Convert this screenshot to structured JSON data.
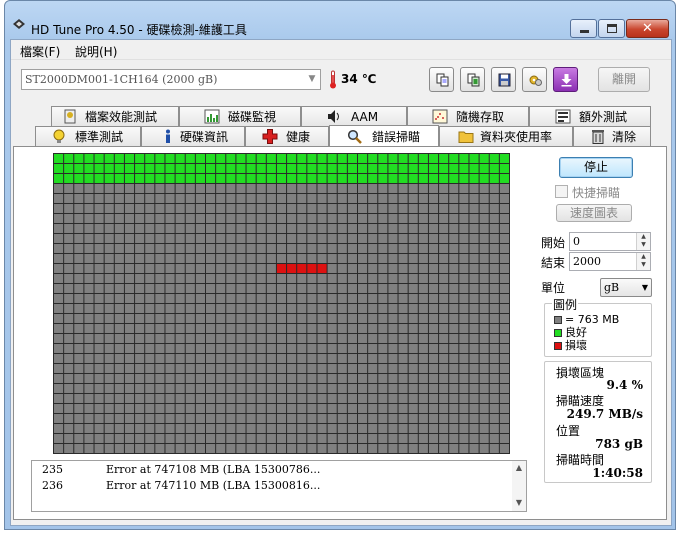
{
  "window": {
    "title": "HD Tune Pro 4.50 - 硬碟檢測-維護工具",
    "minimize_label": "–",
    "close_glyph": "✕"
  },
  "menu": {
    "file": "檔案(F)",
    "help": "說明(H)"
  },
  "toolbar": {
    "drive": "ST2000DM001-1CH164 (2000 gB)",
    "temperature": "34 ℃",
    "exit_label": "離開",
    "icons": [
      "copy-info-icon",
      "copy-screenshot-icon",
      "save-icon",
      "options-icon",
      "download-icon"
    ]
  },
  "tabs": {
    "row1": [
      "檔案效能測試",
      "磁碟監視",
      "AAM",
      "隨機存取",
      "額外測試"
    ],
    "row2": [
      "標準測試",
      "硬碟資訊",
      "健康",
      "錯誤掃瞄",
      "資料夾使用率",
      "清除"
    ],
    "active": "錯誤掃瞄"
  },
  "scan": {
    "grid_cols": 45,
    "grid_rows": 30,
    "scanned_fraction": 0.094,
    "damaged_row": 11,
    "damaged_col_start": 22,
    "damaged_col_end": 27,
    "colors": {
      "good": "#22dd22",
      "bad": "#dd1111",
      "unscanned": "#808080",
      "grid": "#2a2a2a"
    }
  },
  "controls": {
    "stop_label": "停止",
    "quick_scan_label": "快捷掃瞄",
    "speed_map_label": "速度圖表",
    "start_label": "開始",
    "start_value": "0",
    "end_label": "結束",
    "end_value": "2000",
    "unit_label": "單位",
    "unit_value": "gB"
  },
  "legend": {
    "title": "圖例",
    "block_size": "= 763 MB",
    "good": "良好",
    "damaged": "損壞"
  },
  "stats": {
    "damaged_blocks_label": "損壞區塊",
    "damaged_blocks_value": "9.4 %",
    "scan_speed_label": "掃瞄速度",
    "scan_speed_value": "249.7 MB/s",
    "position_label": "位置",
    "position_value": "783 gB",
    "scan_time_label": "掃瞄時間",
    "scan_time_value": "1:40:58"
  },
  "log": [
    {
      "num": "235",
      "msg": "Error at 747108 MB (LBA 15300786..."
    },
    {
      "num": "236",
      "msg": "Error at 747110 MB (LBA 15300816..."
    }
  ]
}
